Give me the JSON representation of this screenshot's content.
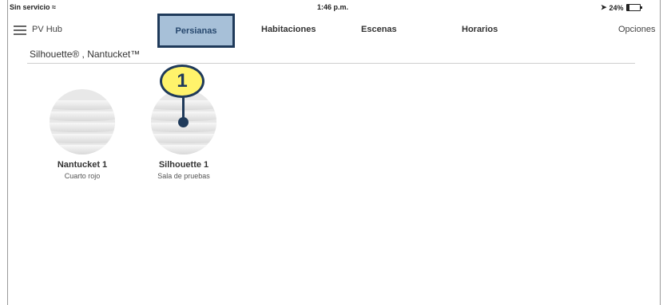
{
  "status_bar": {
    "carrier": "Sin servicio",
    "time": "1:46 p.m.",
    "battery": "24%",
    "battery_level": 0.24
  },
  "nav": {
    "hub_label": "PV Hub",
    "tabs": [
      {
        "label": "Persianas",
        "active": true
      },
      {
        "label": "Habitaciones"
      },
      {
        "label": "Escenas"
      },
      {
        "label": "Horarios"
      }
    ],
    "options_label": "Opciones"
  },
  "filter": {
    "text": "Silhouette® ,  Nantucket™"
  },
  "devices": [
    {
      "name": "Nantucket 1",
      "room": "Cuarto rojo"
    },
    {
      "name": "Silhouette 1",
      "room": "Sala de pruebas"
    }
  ],
  "callout": {
    "number": "1"
  },
  "colors": {
    "active_tab_bg": "#a7c0d8",
    "active_tab_border": "#1f3a5a",
    "callout_fill": "#fff36b"
  }
}
